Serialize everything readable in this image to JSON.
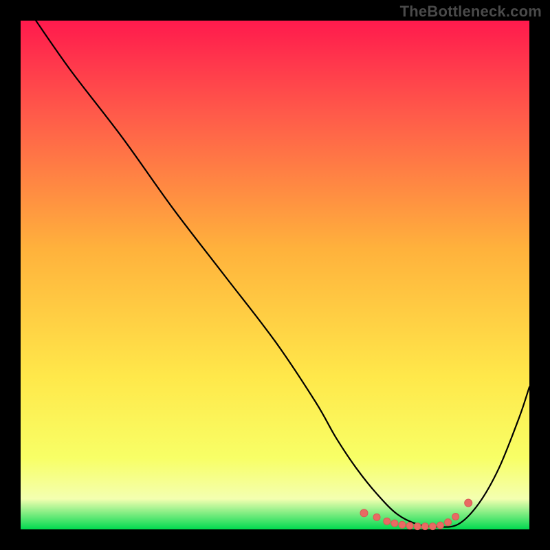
{
  "watermark": "TheBottleneck.com",
  "colors": {
    "background": "#000000",
    "grad_top": "#ff1a4d",
    "grad_mid1": "#ff594a",
    "grad_mid2": "#ffb23c",
    "grad_mid3": "#ffe84a",
    "grad_mid4": "#f8ff66",
    "grad_low": "#f4ffb0",
    "grad_bottom": "#00d94f",
    "curve": "#000000",
    "dot_fill": "#e96a63",
    "dot_stroke": "#d85a55"
  },
  "chart_data": {
    "type": "line",
    "title": "",
    "xlabel": "",
    "ylabel": "",
    "xlim": [
      0,
      100
    ],
    "ylim": [
      0,
      100
    ],
    "series": [
      {
        "name": "bottleneck-curve",
        "x": [
          3,
          10,
          20,
          30,
          40,
          50,
          58,
          62,
          66,
          70,
          74,
          78,
          82,
          86,
          90,
          94,
          98,
          100
        ],
        "y": [
          100,
          90,
          77,
          63,
          50,
          37,
          25,
          18,
          12,
          7,
          3,
          1,
          0.5,
          1,
          5,
          12,
          22,
          28
        ]
      }
    ],
    "dots": {
      "name": "highlight-dots",
      "x": [
        67.5,
        70,
        72,
        73.5,
        75,
        76.5,
        78,
        79.5,
        81,
        82.5,
        84,
        85.5,
        88
      ],
      "y": [
        3.2,
        2.4,
        1.6,
        1.2,
        0.9,
        0.7,
        0.6,
        0.6,
        0.6,
        0.8,
        1.4,
        2.5,
        5.2
      ]
    },
    "annotations": []
  }
}
